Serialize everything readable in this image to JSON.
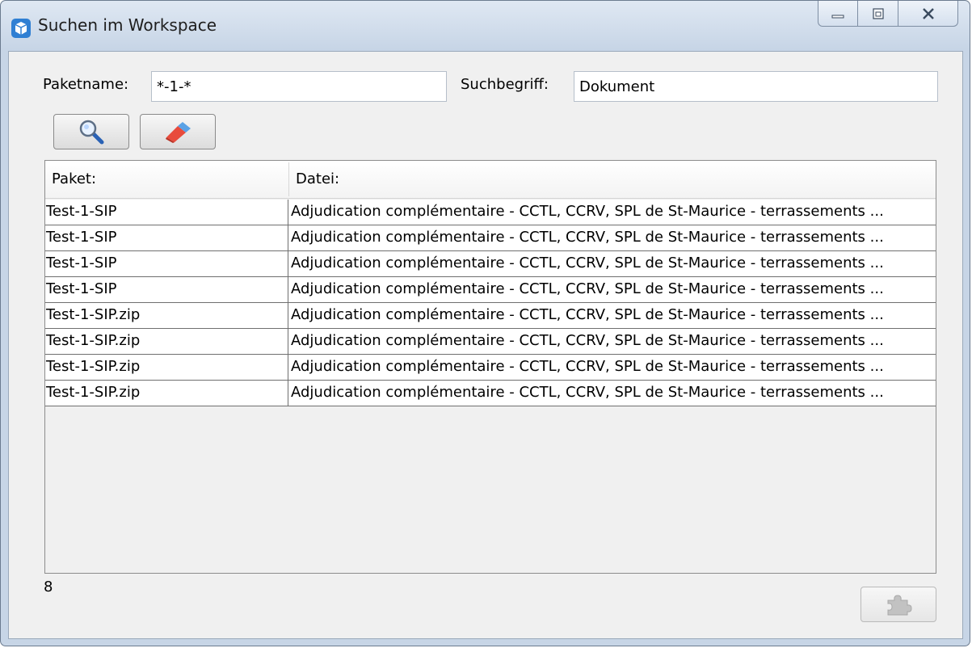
{
  "window": {
    "title": "Suchen im Workspace",
    "controls": [
      "minimize-icon",
      "maximize-icon",
      "close-icon"
    ]
  },
  "form": {
    "paketname_label": "Paketname:",
    "paketname_value": "*-1-*",
    "suchbegriff_label": "Suchbegriff:",
    "suchbegriff_value": "Dokument"
  },
  "toolbar": {
    "search_icon": "magnifier-icon",
    "clear_icon": "eraser-icon"
  },
  "table": {
    "columns": [
      "Paket:",
      "Datei:"
    ],
    "rows": [
      [
        "Test-1-SIP",
        "Adjudication complémentaire - CCTL, CCRV, SPL de St-Maurice - terrassements ..."
      ],
      [
        "Test-1-SIP",
        "Adjudication complémentaire - CCTL, CCRV, SPL de St-Maurice - terrassements ..."
      ],
      [
        "Test-1-SIP",
        "Adjudication complémentaire - CCTL, CCRV, SPL de St-Maurice - terrassements ..."
      ],
      [
        "Test-1-SIP",
        "Adjudication complémentaire - CCTL, CCRV, SPL de St-Maurice - terrassements ..."
      ],
      [
        "Test-1-SIP.zip",
        "Adjudication complémentaire - CCTL, CCRV, SPL de St-Maurice - terrassements ..."
      ],
      [
        "Test-1-SIP.zip",
        "Adjudication complémentaire - CCTL, CCRV, SPL de St-Maurice - terrassements ..."
      ],
      [
        "Test-1-SIP.zip",
        "Adjudication complémentaire - CCTL, CCRV, SPL de St-Maurice - terrassements ..."
      ],
      [
        "Test-1-SIP.zip",
        "Adjudication complémentaire - CCTL, CCRV, SPL de St-Maurice - terrassements ..."
      ]
    ]
  },
  "status": {
    "count": "8",
    "export_icon": "puzzle-icon",
    "export_disabled": true
  }
}
